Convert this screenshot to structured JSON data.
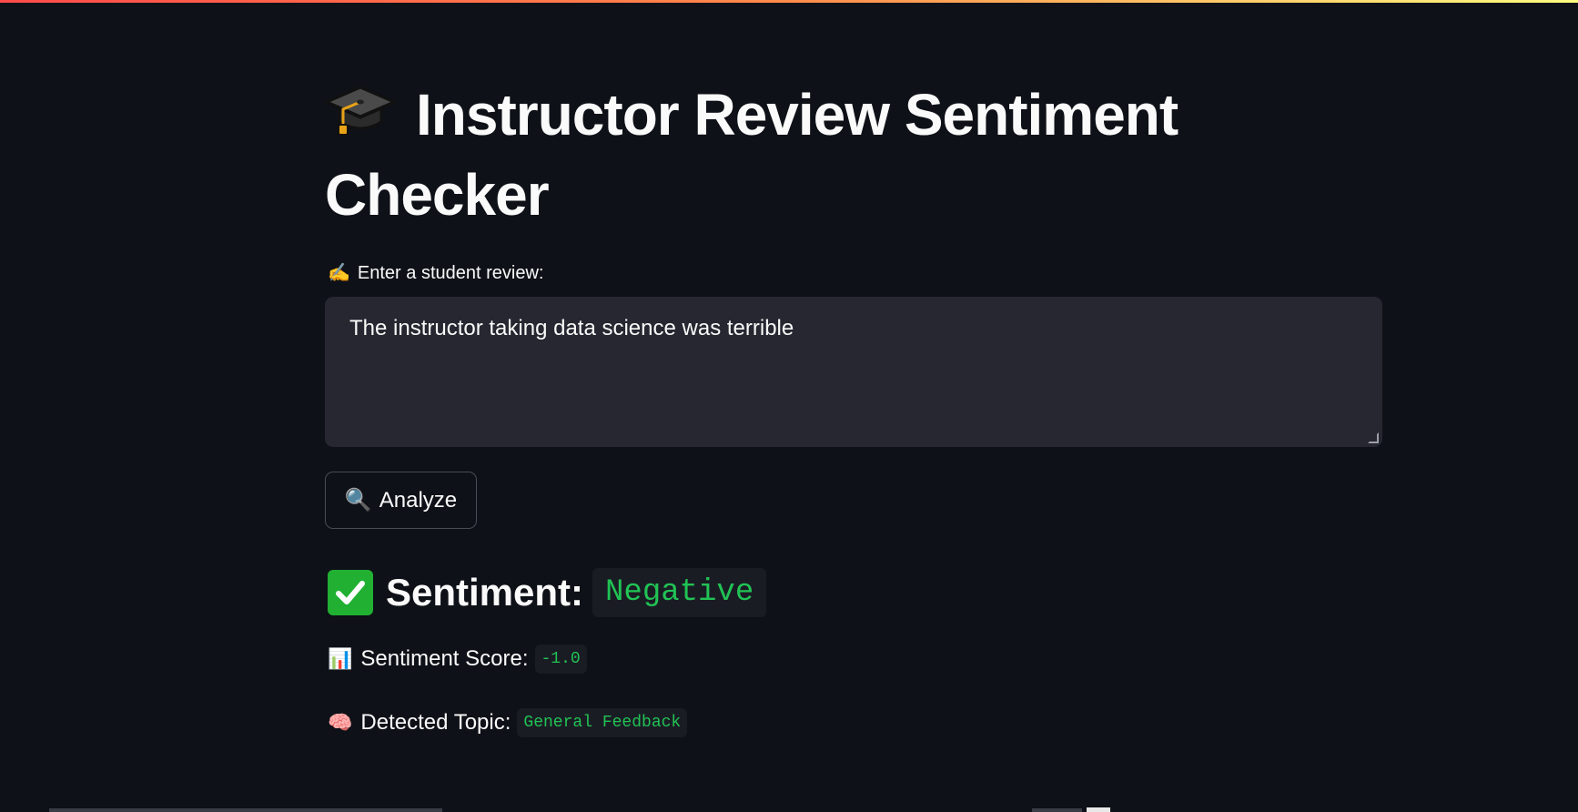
{
  "app": {
    "title": "Instructor Review Sentiment Checker",
    "title_icon": "graduation-cap-icon",
    "accent_gradient": [
      "#ff4b4b",
      "#ff8c4b",
      "#fffd80"
    ]
  },
  "form": {
    "label_emoji": "✍️",
    "label": "Enter a student review:",
    "review_value": "The instructor taking data science was terrible",
    "analyze_emoji": "🔍",
    "analyze_label": "Analyze"
  },
  "result": {
    "sentiment_icon": "check-mark-icon",
    "sentiment_label": "Sentiment:",
    "sentiment_value": "Negative",
    "score_emoji": "📊",
    "score_label": "Sentiment Score:",
    "score_value": "-1.0",
    "topic_emoji": "🧠",
    "topic_label": "Detected Topic:",
    "topic_value": "General Feedback",
    "value_color": "#21c354"
  }
}
